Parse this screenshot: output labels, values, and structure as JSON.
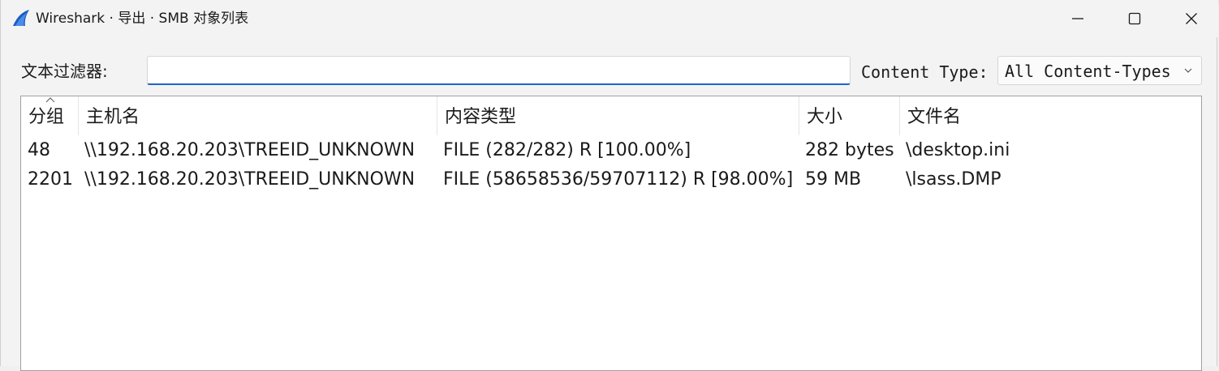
{
  "window": {
    "title": "Wireshark · 导出 · SMB 对象列表",
    "minimize_icon": "minimize-icon",
    "maximize_icon": "maximize-icon",
    "close_icon": "close-icon"
  },
  "filter": {
    "label": "文本过滤器:",
    "value": "",
    "placeholder": ""
  },
  "content_type": {
    "label": "Content Type:",
    "selected": "All Content-Types"
  },
  "table": {
    "columns": [
      "分组",
      "主机名",
      "内容类型",
      "大小",
      "文件名"
    ],
    "sorted_column": "分组",
    "rows": [
      [
        "48",
        "\\\\192.168.20.203\\TREEID_UNKNOWN",
        "FILE (282/282) R [100.00%]",
        "282 bytes",
        "\\desktop.ini"
      ],
      [
        "2201",
        "\\\\192.168.20.203\\TREEID_UNKNOWN",
        "FILE (58658536/59707112) R [98.00%]",
        "59 MB",
        "\\lsass.DMP"
      ]
    ]
  },
  "colors": {
    "accent": "#1f63c9",
    "window_bg": "#f3f3f3",
    "table_bg": "#ffffff"
  }
}
